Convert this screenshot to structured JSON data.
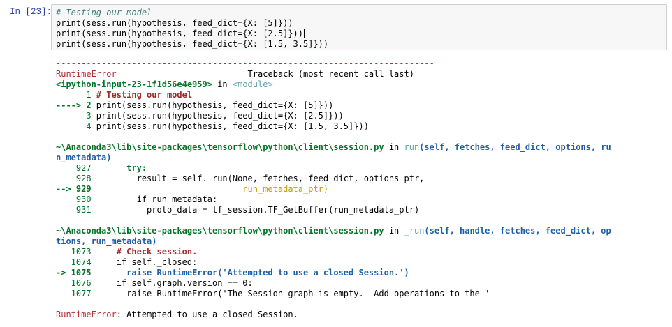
{
  "cell": {
    "prompt": "In [23]:",
    "input_lines": [
      "# Testing our model",
      "print(sess.run(hypothesis, feed_dict={X: [5]}))",
      "print(sess.run(hypothesis, feed_dict={X: [2.5]}))",
      "print(sess.run(hypothesis, feed_dict={X: [1.5, 3.5]}))"
    ]
  },
  "traceback": {
    "dashes": "---------------------------------------------------------------------------",
    "error_name": "RuntimeError",
    "traceback_header": "                          Traceback (most recent call last)",
    "frame1": {
      "location": "<ipython-input-23-1f1d56e4e959>",
      "in_word": " in ",
      "module": "<module>",
      "lines": [
        {
          "marker": "      1 ",
          "code": "# Testing our model"
        },
        {
          "marker": "----> 2 ",
          "code": "print(sess.run(hypothesis, feed_dict={X: [5]}))"
        },
        {
          "marker": "      3 ",
          "code": "print(sess.run(hypothesis, feed_dict={X: [2.5]}))"
        },
        {
          "marker": "      4 ",
          "code": "print(sess.run(hypothesis, feed_dict={X: [1.5, 3.5]}))"
        }
      ]
    },
    "frame2": {
      "path": "~\\Anaconda3\\lib\\site-packages\\tensorflow\\python\\client\\session.py",
      "in_word": " in ",
      "func": "run",
      "args_line1": "(self, fetches, feed_dict, options, ru",
      "args_line2": "n_metadata)",
      "lines": [
        {
          "marker": "    927 ",
          "code": "      try:"
        },
        {
          "marker": "    928 ",
          "code": "        result = self._run(None, fetches, feed_dict, options_ptr,"
        },
        {
          "marker": "--> 929 ",
          "code": "                             run_metadata_ptr)"
        },
        {
          "marker": "    930 ",
          "code": "        if run_metadata:"
        },
        {
          "marker": "    931 ",
          "code": "          proto_data = tf_session.TF_GetBuffer(run_metadata_ptr)"
        }
      ]
    },
    "frame3": {
      "path": "~\\Anaconda3\\lib\\site-packages\\tensorflow\\python\\client\\session.py",
      "in_word": " in ",
      "func": "_run",
      "args_line1": "(self, handle, fetches, feed_dict, op",
      "args_line2": "tions, run_metadata)",
      "lines": [
        {
          "marker": "   1073 ",
          "code": "    # Check session."
        },
        {
          "marker": "   1074 ",
          "code": "    if self._closed:"
        },
        {
          "marker": "-> 1075 ",
          "code": "      raise RuntimeError('Attempted to use a closed Session.')"
        },
        {
          "marker": "   1076 ",
          "code": "    if self.graph.version == 0:"
        },
        {
          "marker": "   1077 ",
          "code": "      raise RuntimeError('The Session graph is empty.  Add operations to the '"
        }
      ]
    },
    "final_error_name": "RuntimeError",
    "final_error_msg": ": Attempted to use a closed Session."
  }
}
